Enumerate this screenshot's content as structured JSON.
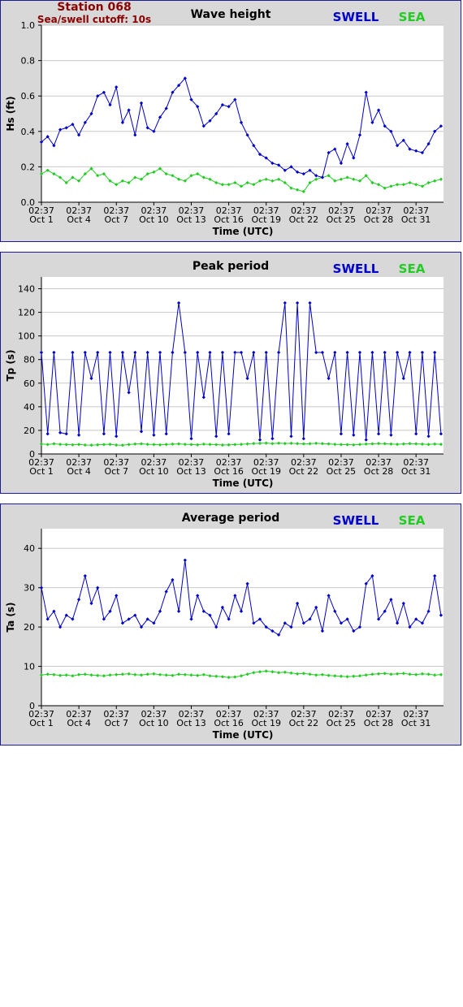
{
  "header": {
    "station": "Station 068",
    "cutoff": "Sea/swell cutoff: 10s"
  },
  "legend": {
    "swell": "SWELL",
    "sea": "SEA"
  },
  "colors": {
    "swell": "#0000cc",
    "sea": "#22cc22",
    "title_red": "#8b0000",
    "panel_bg": "#d8d8d8",
    "plot_bg": "#ffffff",
    "grid": "#c8c8c8"
  },
  "x_ticks": [
    {
      "time": "02:37",
      "date": "Oct 1"
    },
    {
      "time": "02:37",
      "date": "Oct 4"
    },
    {
      "time": "02:37",
      "date": "Oct 7"
    },
    {
      "time": "02:37",
      "date": "Oct 10"
    },
    {
      "time": "02:37",
      "date": "Oct 13"
    },
    {
      "time": "02:37",
      "date": "Oct 16"
    },
    {
      "time": "02:37",
      "date": "Oct 19"
    },
    {
      "time": "02:37",
      "date": "Oct 22"
    },
    {
      "time": "02:37",
      "date": "Oct 25"
    },
    {
      "time": "02:37",
      "date": "Oct 28"
    },
    {
      "time": "02:37",
      "date": "Oct 31"
    }
  ],
  "chart_data": [
    {
      "type": "line",
      "title": "Wave height",
      "xlabel": "Time (UTC)",
      "ylabel": "Hs (ft)",
      "ylim": [
        0,
        1.0
      ],
      "yticks": [
        "0.0",
        "0.2",
        "0.4",
        "0.6",
        "0.8",
        "1.0"
      ],
      "ytick_values": [
        0,
        0.2,
        0.4,
        0.6,
        0.8,
        1.0
      ],
      "grid": true,
      "legend_position": "top-right",
      "x_range_days": [
        1,
        33.2
      ],
      "series": [
        {
          "name": "SWELL",
          "x_days": [
            1,
            1.5,
            2,
            2.5,
            3,
            3.5,
            4,
            4.5,
            5,
            5.5,
            6,
            6.5,
            7,
            7.5,
            8,
            8.5,
            9,
            9.5,
            10,
            10.5,
            11,
            11.5,
            12,
            12.5,
            13,
            13.5,
            14,
            14.5,
            15,
            15.5,
            16,
            16.5,
            17,
            17.5,
            18,
            18.5,
            19,
            19.5,
            20,
            20.5,
            21,
            21.5,
            22,
            22.5,
            23,
            23.5,
            24,
            24.5,
            25,
            25.5,
            26,
            26.5,
            27,
            27.5,
            28,
            28.5,
            29,
            29.5,
            30,
            30.5,
            31,
            31.5,
            32,
            32.5,
            33
          ],
          "values": [
            0.34,
            0.37,
            0.32,
            0.41,
            0.42,
            0.44,
            0.38,
            0.45,
            0.5,
            0.6,
            0.62,
            0.55,
            0.65,
            0.45,
            0.52,
            0.38,
            0.56,
            0.42,
            0.4,
            0.48,
            0.53,
            0.62,
            0.66,
            0.7,
            0.58,
            0.54,
            0.43,
            0.46,
            0.5,
            0.55,
            0.54,
            0.58,
            0.45,
            0.38,
            0.32,
            0.27,
            0.25,
            0.22,
            0.21,
            0.18,
            0.2,
            0.17,
            0.16,
            0.18,
            0.15,
            0.14,
            0.28,
            0.3,
            0.22,
            0.33,
            0.25,
            0.38,
            0.62,
            0.45,
            0.52,
            0.43,
            0.4,
            0.32,
            0.35,
            0.3,
            0.29,
            0.28,
            0.33,
            0.4,
            0.43
          ]
        },
        {
          "name": "SEA",
          "x_days": [
            1,
            1.5,
            2,
            2.5,
            3,
            3.5,
            4,
            4.5,
            5,
            5.5,
            6,
            6.5,
            7,
            7.5,
            8,
            8.5,
            9,
            9.5,
            10,
            10.5,
            11,
            11.5,
            12,
            12.5,
            13,
            13.5,
            14,
            14.5,
            15,
            15.5,
            16,
            16.5,
            17,
            17.5,
            18,
            18.5,
            19,
            19.5,
            20,
            20.5,
            21,
            21.5,
            22,
            22.5,
            23,
            23.5,
            24,
            24.5,
            25,
            25.5,
            26,
            26.5,
            27,
            27.5,
            28,
            28.5,
            29,
            29.5,
            30,
            30.5,
            31,
            31.5,
            32,
            32.5,
            33
          ],
          "values": [
            0.16,
            0.18,
            0.16,
            0.14,
            0.11,
            0.14,
            0.12,
            0.16,
            0.19,
            0.15,
            0.16,
            0.12,
            0.1,
            0.12,
            0.11,
            0.14,
            0.13,
            0.16,
            0.17,
            0.19,
            0.16,
            0.15,
            0.13,
            0.12,
            0.15,
            0.16,
            0.14,
            0.13,
            0.11,
            0.1,
            0.1,
            0.11,
            0.09,
            0.11,
            0.1,
            0.12,
            0.13,
            0.12,
            0.13,
            0.11,
            0.08,
            0.07,
            0.06,
            0.11,
            0.13,
            0.14,
            0.15,
            0.12,
            0.13,
            0.14,
            0.13,
            0.12,
            0.15,
            0.11,
            0.1,
            0.08,
            0.09,
            0.1,
            0.1,
            0.11,
            0.1,
            0.09,
            0.11,
            0.12,
            0.13
          ]
        }
      ]
    },
    {
      "type": "line",
      "title": "Peak period",
      "xlabel": "Time (UTC)",
      "ylabel": "Tp (s)",
      "ylim": [
        0,
        150
      ],
      "yticks": [
        "0",
        "20",
        "40",
        "60",
        "80",
        "100",
        "120",
        "140"
      ],
      "ytick_values": [
        0,
        20,
        40,
        60,
        80,
        100,
        120,
        140
      ],
      "grid": true,
      "legend_position": "top-right",
      "x_range_days": [
        1,
        33.2
      ],
      "series": [
        {
          "name": "SWELL",
          "x_days": [
            1,
            1.5,
            2,
            2.5,
            3,
            3.5,
            4,
            4.5,
            5,
            5.5,
            6,
            6.5,
            7,
            7.5,
            8,
            8.5,
            9,
            9.5,
            10,
            10.5,
            11,
            11.5,
            12,
            12.5,
            13,
            13.5,
            14,
            14.5,
            15,
            15.5,
            16,
            16.5,
            17,
            17.5,
            18,
            18.5,
            19,
            19.5,
            20,
            20.5,
            21,
            21.5,
            22,
            22.5,
            23,
            23.5,
            24,
            24.5,
            25,
            25.5,
            26,
            26.5,
            27,
            27.5,
            28,
            28.5,
            29,
            29.5,
            30,
            30.5,
            31,
            31.5,
            32,
            32.5,
            33
          ],
          "values": [
            86,
            17,
            86,
            18,
            17,
            86,
            16,
            86,
            64,
            86,
            17,
            86,
            15,
            86,
            52,
            86,
            19,
            86,
            16,
            86,
            17,
            86,
            128,
            86,
            13,
            86,
            48,
            86,
            15,
            86,
            17,
            86,
            86,
            64,
            86,
            12,
            86,
            13,
            86,
            128,
            15,
            128,
            13,
            128,
            86,
            86,
            64,
            86,
            17,
            86,
            16,
            86,
            12,
            86,
            17,
            86,
            16,
            86,
            64,
            86,
            17,
            86,
            15,
            86,
            17
          ]
        },
        {
          "name": "SEA",
          "x_days": [
            1,
            1.5,
            2,
            2.5,
            3,
            3.5,
            4,
            4.5,
            5,
            5.5,
            6,
            6.5,
            7,
            7.5,
            8,
            8.5,
            9,
            9.5,
            10,
            10.5,
            11,
            11.5,
            12,
            12.5,
            13,
            13.5,
            14,
            14.5,
            15,
            15.5,
            16,
            16.5,
            17,
            17.5,
            18,
            18.5,
            19,
            19.5,
            20,
            20.5,
            21,
            21.5,
            22,
            22.5,
            23,
            23.5,
            24,
            24.5,
            25,
            25.5,
            26,
            26.5,
            27,
            27.5,
            28,
            28.5,
            29,
            29.5,
            30,
            30.5,
            31,
            31.5,
            32,
            32.5,
            33
          ],
          "values": [
            8.5,
            8.0,
            8.6,
            8.2,
            8.0,
            7.8,
            8.1,
            7.6,
            7.5,
            7.8,
            8.0,
            8.2,
            7.6,
            7.4,
            8.0,
            8.4,
            8.6,
            8.2,
            8.0,
            7.8,
            8.1,
            8.3,
            8.5,
            8.2,
            8.0,
            7.8,
            8.3,
            8.1,
            7.9,
            7.6,
            7.8,
            8.0,
            8.2,
            8.5,
            8.9,
            9.0,
            9.2,
            8.8,
            9.1,
            8.9,
            9.0,
            8.8,
            8.6,
            8.7,
            9.0,
            8.8,
            8.5,
            8.2,
            8.0,
            7.9,
            7.8,
            8.1,
            8.4,
            8.6,
            8.9,
            8.7,
            8.4,
            8.2,
            8.5,
            8.8,
            8.6,
            8.3,
            8.1,
            8.4,
            8.2
          ]
        }
      ]
    },
    {
      "type": "line",
      "title": "Average period",
      "xlabel": "Time (UTC)",
      "ylabel": "Ta (s)",
      "ylim": [
        0,
        45
      ],
      "yticks": [
        "0",
        "10",
        "20",
        "30",
        "40"
      ],
      "ytick_values": [
        0,
        10,
        20,
        30,
        40
      ],
      "grid": true,
      "legend_position": "top-right",
      "x_range_days": [
        1,
        33.2
      ],
      "series": [
        {
          "name": "SWELL",
          "x_days": [
            1,
            1.5,
            2,
            2.5,
            3,
            3.5,
            4,
            4.5,
            5,
            5.5,
            6,
            6.5,
            7,
            7.5,
            8,
            8.5,
            9,
            9.5,
            10,
            10.5,
            11,
            11.5,
            12,
            12.5,
            13,
            13.5,
            14,
            14.5,
            15,
            15.5,
            16,
            16.5,
            17,
            17.5,
            18,
            18.5,
            19,
            19.5,
            20,
            20.5,
            21,
            21.5,
            22,
            22.5,
            23,
            23.5,
            24,
            24.5,
            25,
            25.5,
            26,
            26.5,
            27,
            27.5,
            28,
            28.5,
            29,
            29.5,
            30,
            30.5,
            31,
            31.5,
            32,
            32.5,
            33
          ],
          "values": [
            30,
            22,
            24,
            20,
            23,
            22,
            27,
            33,
            26,
            30,
            22,
            24,
            28,
            21,
            22,
            23,
            20,
            22,
            21,
            24,
            29,
            32,
            24,
            37,
            22,
            28,
            24,
            23,
            20,
            25,
            22,
            28,
            24,
            31,
            21,
            22,
            20,
            19,
            18,
            21,
            20,
            26,
            21,
            22,
            25,
            19,
            28,
            24,
            21,
            22,
            19,
            20,
            31,
            33,
            22,
            24,
            27,
            21,
            26,
            20,
            22,
            21,
            24,
            33,
            23
          ]
        },
        {
          "name": "SEA",
          "x_days": [
            1,
            1.5,
            2,
            2.5,
            3,
            3.5,
            4,
            4.5,
            5,
            5.5,
            6,
            6.5,
            7,
            7.5,
            8,
            8.5,
            9,
            9.5,
            10,
            10.5,
            11,
            11.5,
            12,
            12.5,
            13,
            13.5,
            14,
            14.5,
            15,
            15.5,
            16,
            16.5,
            17,
            17.5,
            18,
            18.5,
            19,
            19.5,
            20,
            20.5,
            21,
            21.5,
            22,
            22.5,
            23,
            23.5,
            24,
            24.5,
            25,
            25.5,
            26,
            26.5,
            27,
            27.5,
            28,
            28.5,
            29,
            29.5,
            30,
            30.5,
            31,
            31.5,
            32,
            32.5,
            33
          ],
          "values": [
            7.8,
            8.0,
            7.9,
            7.7,
            7.8,
            7.6,
            7.9,
            8.0,
            7.8,
            7.7,
            7.6,
            7.8,
            7.9,
            8.0,
            8.1,
            7.9,
            7.8,
            8.0,
            8.1,
            7.9,
            7.8,
            7.7,
            8.0,
            7.9,
            7.8,
            7.7,
            7.9,
            7.6,
            7.5,
            7.4,
            7.2,
            7.3,
            7.6,
            8.0,
            8.4,
            8.6,
            8.8,
            8.6,
            8.4,
            8.5,
            8.3,
            8.1,
            8.2,
            8.0,
            7.8,
            7.9,
            7.7,
            7.6,
            7.5,
            7.4,
            7.5,
            7.6,
            7.8,
            8.0,
            8.1,
            8.2,
            8.0,
            8.1,
            8.2,
            8.0,
            7.9,
            8.1,
            8.0,
            7.8,
            7.9
          ]
        }
      ]
    }
  ]
}
